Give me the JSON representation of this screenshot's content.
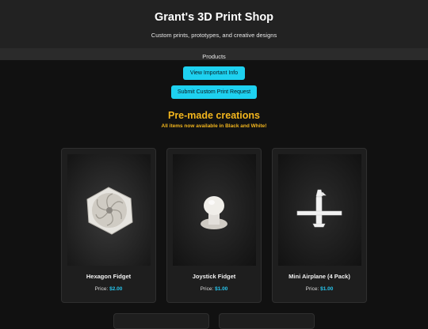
{
  "header": {
    "title": "Grant's 3D Print Shop",
    "tagline": "Custom prints, prototypes, and creative designs"
  },
  "nav": {
    "products": "Products"
  },
  "buttons": {
    "info": "View Important Info",
    "request": "Submit Custom Print Request"
  },
  "section": {
    "title": "Pre-made creations",
    "subtitle": "All items now available in Black and White!"
  },
  "products": [
    {
      "name": "Hexagon Fidget",
      "price_label": "Price:",
      "price": "$2.00"
    },
    {
      "name": "Joystick Fidget",
      "price_label": "Price:",
      "price": "$1.00"
    },
    {
      "name": "Mini Airplane (4 Pack)",
      "price_label": "Price:",
      "price": "$1.00"
    }
  ],
  "colors": {
    "accent": "#1ed1f0",
    "heading": "#f2b51d",
    "price": "#27c7f0",
    "background": "#111111"
  }
}
